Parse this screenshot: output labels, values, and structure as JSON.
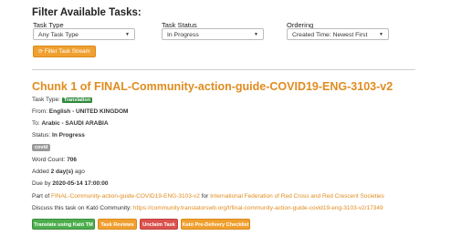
{
  "filters": {
    "title": "Filter Available Tasks:",
    "task_type": {
      "label": "Task Type",
      "value": "Any Task Type"
    },
    "task_status": {
      "label": "Task Status",
      "value": "In Progress"
    },
    "ordering": {
      "label": "Ordering",
      "value": "Created Time: Newest First"
    },
    "filter_button": "Filter Task Stream"
  },
  "task": {
    "title": "Chunk 1 of FINAL-Community-action-guide-COVID19-ENG-3103-v2",
    "type_label": "Task Type:",
    "type_badge": "Translation",
    "from_label": "From:",
    "from_value": "English - UNITED KINGDOM",
    "to_label": "To:",
    "to_value": "Arabic - SAUDI ARABIA",
    "status_label": "Status:",
    "status_value": "In Progress",
    "tag": "covid",
    "word_count_label": "Word Count:",
    "word_count_value": "706",
    "added_label": "Added",
    "added_value": "2 day(s)",
    "added_suffix": "ago",
    "due_label": "Due by",
    "due_value": "2020-05-14 17:00:00",
    "part_of_label": "Part of",
    "part_of_project": "FINAL-Community-action-guide-COVID19-ENG-3103-v2",
    "for_label": "for",
    "organisation": "International Federation of Red Cross and Red Crescent Societies",
    "discuss_label": "Discuss this task on Kató Community:",
    "discuss_link": "https://community.translatorswb.org/t/final-community-action-guide-covid19-eng-3103-v2/17349"
  },
  "actions": {
    "translate": "Translate using Kató TM",
    "reviews": "Task Reviews",
    "unclaim": "Unclaim Task",
    "checklist": "Kató Pre-Delivery Checklist"
  },
  "colors": {
    "accent": "#e08c1f",
    "button_orange": "#f0a030",
    "button_green": "#4cae4c",
    "button_red": "#d9534f",
    "badge_green": "#2e8b3a"
  },
  "icons": {
    "filter_button": "refresh-icon",
    "select": "caret-down-icon"
  }
}
